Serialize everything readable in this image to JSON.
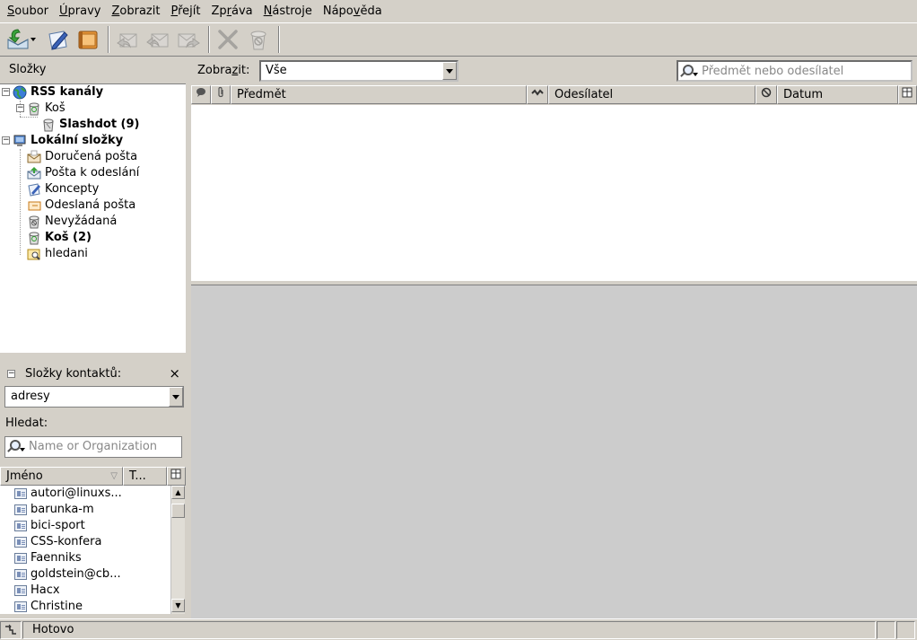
{
  "menu": [
    {
      "pre": "",
      "key": "S",
      "post": "oubor"
    },
    {
      "pre": "",
      "key": "Ú",
      "post": "pravy"
    },
    {
      "pre": "",
      "key": "Z",
      "post": "obrazit"
    },
    {
      "pre": "",
      "key": "P",
      "post": "řejít"
    },
    {
      "pre": "Zp",
      "key": "r",
      "post": "áva"
    },
    {
      "pre": "",
      "key": "N",
      "post": "ástroje"
    },
    {
      "pre": "Nápo",
      "key": "v",
      "post": "ěda"
    }
  ],
  "toolbar": {
    "icons": [
      "get-mail-icon",
      "write-icon",
      "address-book-icon",
      "reply-icon",
      "reply-all-icon",
      "forward-icon",
      "delete-icon",
      "junk-icon"
    ]
  },
  "folders": {
    "header": "Složky",
    "items": [
      {
        "label": "RSS kanály",
        "bold": true
      },
      {
        "label": "Koš",
        "bold": false
      },
      {
        "label": "Slashdot (9)",
        "bold": true
      },
      {
        "label": "Lokální složky",
        "bold": true
      },
      {
        "label": "Doručená pošta",
        "bold": false
      },
      {
        "label": "Pošta k odeslání",
        "bold": false
      },
      {
        "label": "Koncepty",
        "bold": false
      },
      {
        "label": "Odeslaná pošta",
        "bold": false
      },
      {
        "label": "Nevyžádaná",
        "bold": false
      },
      {
        "label": "Koš (2)",
        "bold": true
      },
      {
        "label": "hledani",
        "bold": false
      }
    ]
  },
  "contacts": {
    "header": "Složky kontaktů:",
    "close": "×",
    "book": "adresy",
    "search_label": "Hledat:",
    "search_placeholder": "Name or Organization",
    "col_name": "Jméno",
    "col_type": "T...",
    "items": [
      "autori@linuxs...",
      "barunka-m",
      "bici-sport",
      "CSS-konfera",
      "Faenniks",
      "goldstein@cb...",
      "Hacx",
      "Christine"
    ]
  },
  "filter": {
    "label_pre": "Zobra",
    "label_key": "z",
    "label_post": "it:",
    "value": "Vše",
    "search_placeholder": "Předmět nebo odesílatel"
  },
  "columns": {
    "subject": "Předmět",
    "sender": "Odesílatel",
    "date": "Datum"
  },
  "status": {
    "text": "Hotovo"
  }
}
